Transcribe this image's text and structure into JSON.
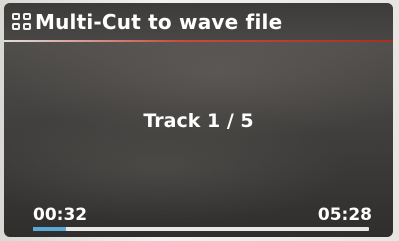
{
  "header": {
    "icon": "menu-grid-icon",
    "title": "Multi-Cut to wave file"
  },
  "main": {
    "track_label": "Track 1 / 5"
  },
  "playback": {
    "elapsed": "00:32",
    "total": "05:28",
    "progress_fraction": 0.0976
  },
  "colors": {
    "title_underline_accent": "#c94a3a",
    "progress_fill": "#5aa9d8",
    "progress_track": "#e8e8e8"
  }
}
